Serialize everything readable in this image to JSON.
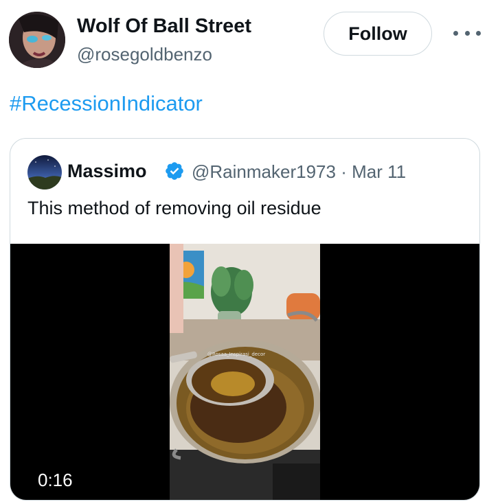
{
  "author": {
    "name": "Wolf Of Ball Street",
    "handle": "@rosegoldbenzo",
    "avatar_icon": "profile-avatar"
  },
  "follow_label": "Follow",
  "more_icon": "more-options-icon",
  "hashtag": "#RecessionIndicator",
  "quoted": {
    "name": "Massimo",
    "verified_icon": "verified-badge-icon",
    "handle": "@Rainmaker1973",
    "separator": "·",
    "date": "Mar 11",
    "text": "This method of removing oil residue",
    "video": {
      "duration": "0:16",
      "watermark": "@Rosaa_Inspirasi_decor"
    }
  },
  "colors": {
    "link": "#1d9bf0",
    "verified": "#1d9bf0",
    "secondary_text": "#536471",
    "border": "#cfd9de"
  }
}
